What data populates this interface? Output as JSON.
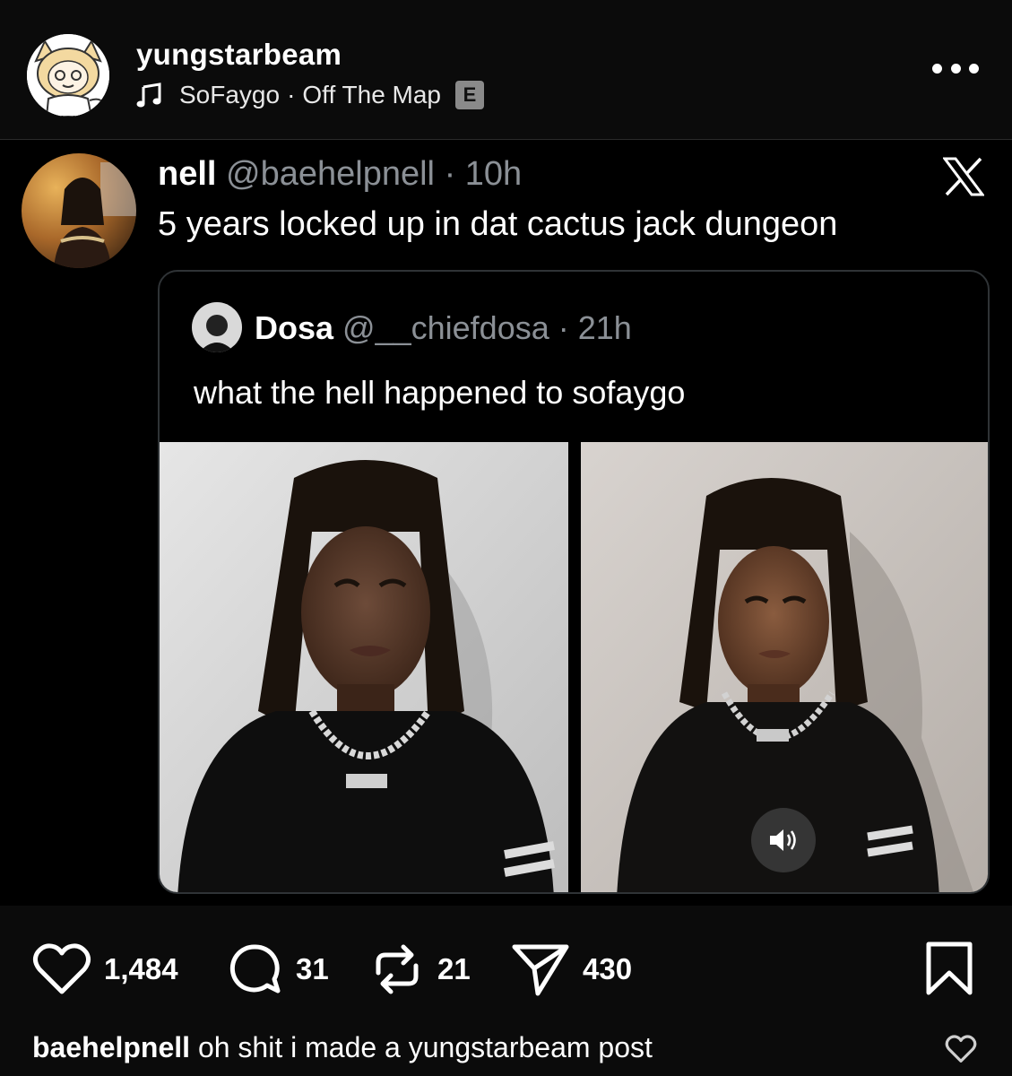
{
  "header": {
    "username": "yungstarbeam",
    "music": {
      "artist": "SoFaygo",
      "separator": "·",
      "song": "Off The Map",
      "explicit_badge": "E"
    },
    "more_icon": "more-horizontal-icon"
  },
  "tweet": {
    "display_name": "nell",
    "handle": "@baehelpnell",
    "time": "· 10h",
    "text": "5 years locked up in dat cactus jack dungeon",
    "platform_icon": "x-logo-icon",
    "quote": {
      "display_name": "Dosa",
      "handle": "@__chiefdosa",
      "time": "· 21h",
      "text": "what the hell happened to sofaygo"
    },
    "sound_icon": "speaker-icon"
  },
  "actions": {
    "likes": "1,484",
    "comments": "31",
    "reposts": "21",
    "shares": "430"
  },
  "caption": {
    "username": "baehelpnell",
    "text": " oh shit i made a yungstarbeam post"
  },
  "colors": {
    "background": "#000000",
    "bar_background": "#0b0b0b",
    "secondary_text": "#8b9096",
    "border": "#2f3336"
  }
}
